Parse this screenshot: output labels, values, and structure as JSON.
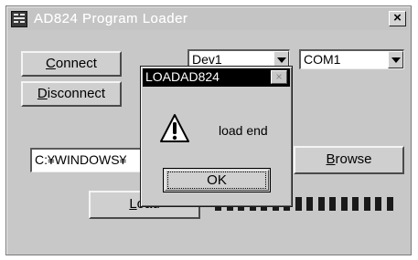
{
  "window": {
    "title": "AD824 Program Loader",
    "close_glyph": "×",
    "icon": "ad824-app-icon"
  },
  "buttons": {
    "connect": {
      "label": "Connect",
      "mnemonic": "C",
      "rest": "onnect"
    },
    "disconnect": {
      "label": "Disconnect",
      "mnemonic": "D",
      "rest": "isconnect"
    },
    "browse": {
      "label": "Browse",
      "mnemonic": "B",
      "rest": "rowse"
    },
    "load": {
      "label": "Load",
      "mnemonic": "L",
      "rest": "oad"
    }
  },
  "device_select": {
    "value": "Dev1"
  },
  "port_select": {
    "value": "COM1"
  },
  "file_path": {
    "value": "C:¥WINDOWS¥"
  },
  "progress": {
    "segments_filled": 16,
    "segments_total": 16,
    "fraction": 1.0
  },
  "dialog": {
    "title": "LOADAD824",
    "close_glyph": "×",
    "message": "load end",
    "ok_label": "OK",
    "icon": "warning-icon"
  }
}
